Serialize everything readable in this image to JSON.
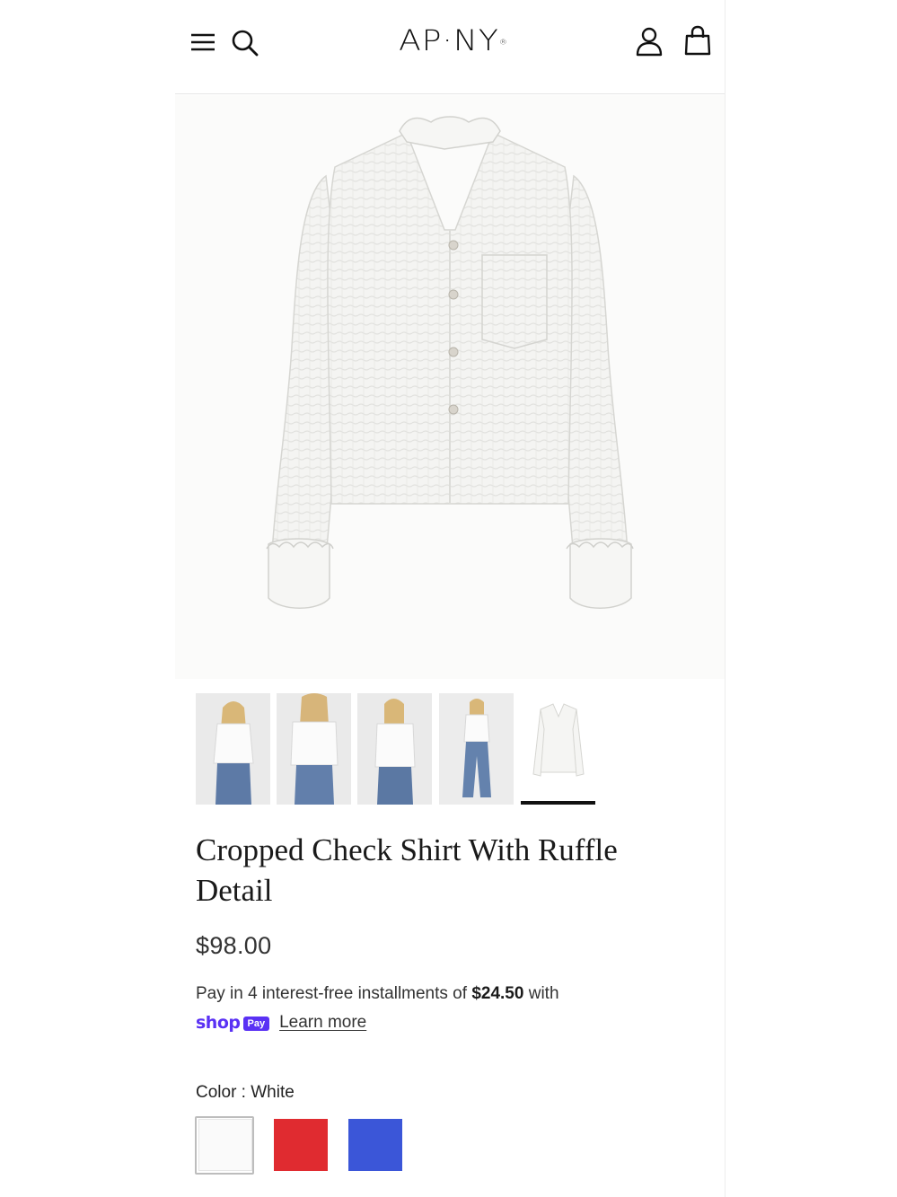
{
  "header": {
    "logo": "AP·NY",
    "logo_mark": "®",
    "icons": [
      "menu-icon",
      "search-icon",
      "account-icon",
      "bag-icon"
    ]
  },
  "gallery": {
    "thumbnails": [
      {
        "name": "front-on-model"
      },
      {
        "name": "back-on-model"
      },
      {
        "name": "side-on-model"
      },
      {
        "name": "full-length-on-model"
      },
      {
        "name": "flat-product",
        "active": true
      }
    ]
  },
  "product": {
    "title": "Cropped Check Shirt With Ruffle Detail",
    "price": "$98.00",
    "installments_prefix": "Pay in 4 interest-free installments of ",
    "installments_amount": "$24.50",
    "installments_suffix": " with",
    "shop_word": "shop",
    "pay_badge": "Pay",
    "learn_more": "Learn more"
  },
  "color": {
    "label": "Color : White",
    "options": [
      {
        "name": "White",
        "hex": "#fafafa",
        "selected": true
      },
      {
        "name": "Red",
        "hex": "#e02b30"
      },
      {
        "name": "Blue",
        "hex": "#3b56d8"
      }
    ]
  }
}
